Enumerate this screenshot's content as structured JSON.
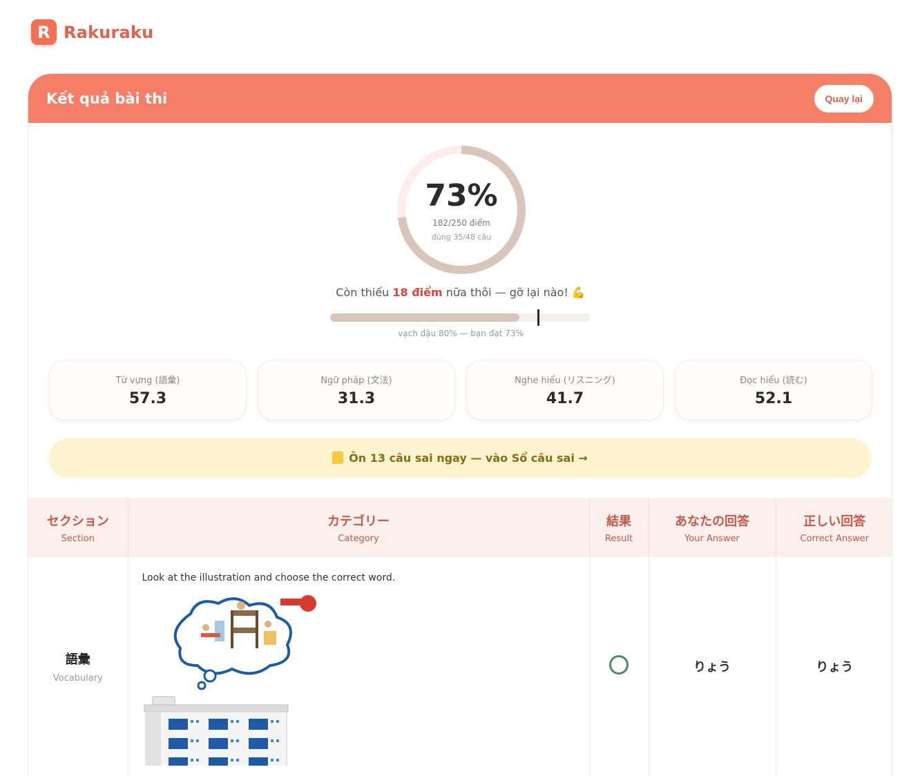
{
  "brand": {
    "logo_letter": "R",
    "name": "Rakuraku"
  },
  "header": {
    "title": "Kết quả bài thi",
    "back_label": "Quay lại"
  },
  "score": {
    "percent": 0.73,
    "percent_text": "73%",
    "points": "182/250 điểm",
    "correct": "đúng 35/48 câu"
  },
  "message": {
    "prefix": "Còn thiếu ",
    "highlight": "18 điểm",
    "suffix": " nữa thôi — gỡ lại nào! 💪"
  },
  "progress": {
    "value": 0.73,
    "pass_mark": 0.8,
    "caption": "vạch đậu 80% — bạn đạt 73%"
  },
  "sections": [
    {
      "label": "Từ vựng (語彙)",
      "value": "57.3"
    },
    {
      "label": "Ngữ pháp (文法)",
      "value": "31.3"
    },
    {
      "label": "Nghe hiểu (リスニング)",
      "value": "41.7"
    },
    {
      "label": "Đọc hiểu (読む)",
      "value": "52.1"
    }
  ],
  "review": {
    "label": "Ôn 13 câu sai ngay — vào Sổ câu sai →",
    "icon": "note-icon"
  },
  "table": {
    "columns": [
      {
        "jp": "セクション",
        "en": "Section"
      },
      {
        "jp": "カテゴリー",
        "en": "Category"
      },
      {
        "jp": "結果",
        "en": "Result"
      },
      {
        "jp": "あなたの回答",
        "en": "Your Answer"
      },
      {
        "jp": "正しい回答",
        "en": "Correct Answer"
      }
    ],
    "rows": [
      {
        "section_jp": "語彙",
        "section_en": "Vocabulary",
        "question": "Look at the illustration and choose the correct word.",
        "result_icon": "correct-circle-icon",
        "your_answer": "りょう",
        "correct_answer": "りょう"
      }
    ]
  },
  "colors": {
    "accent": "#f57e66",
    "brand": "#e4614a",
    "ring": "#d9c6bb",
    "highlight": "#d7453b",
    "review_bg": "#fdf3cf"
  }
}
